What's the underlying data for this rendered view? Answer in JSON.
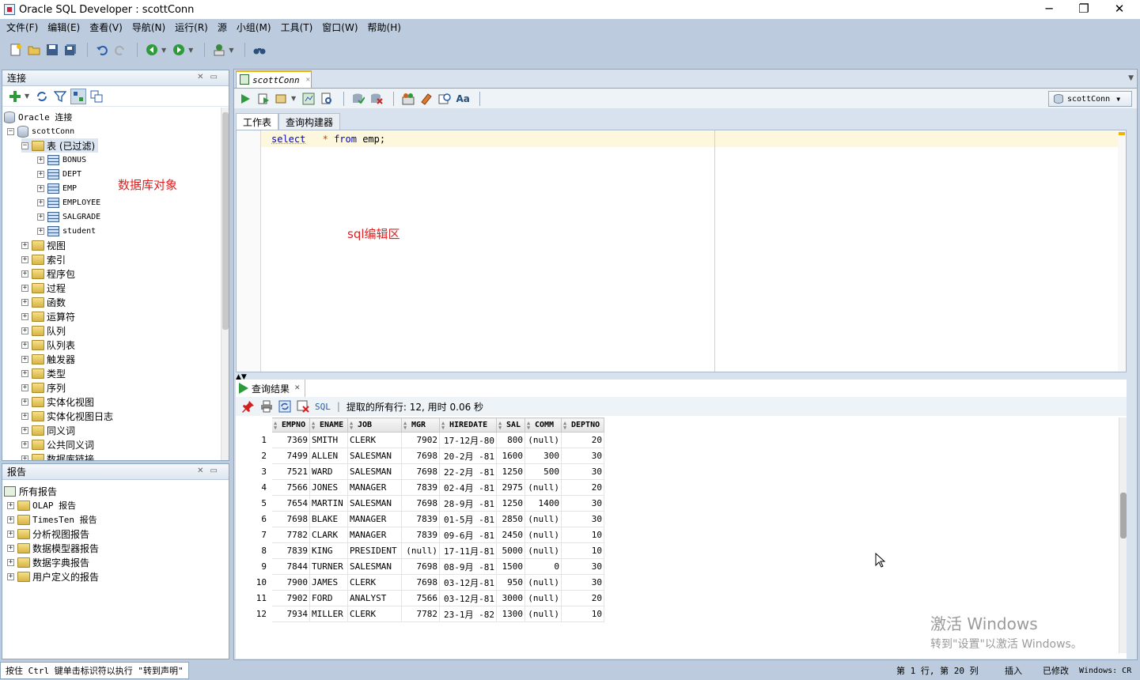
{
  "window": {
    "title": "Oracle SQL Developer : scottConn",
    "min": "─",
    "max": "❐",
    "close": "✕"
  },
  "menu": [
    "文件(F)",
    "编辑(E)",
    "查看(V)",
    "导航(N)",
    "运行(R)",
    "源",
    "小组(M)",
    "工具(T)",
    "窗口(W)",
    "帮助(H)"
  ],
  "connections_panel": {
    "title": "连接",
    "root": "Oracle 连接",
    "connection": "scottConn",
    "tables_node": "表 (已过滤)",
    "tables": [
      "BONUS",
      "DEPT",
      "EMP",
      "EMPLOYEE",
      "SALGRADE",
      "student"
    ],
    "annotation": "数据库对象",
    "nodes": [
      "视图",
      "索引",
      "程序包",
      "过程",
      "函数",
      "运算符",
      "队列",
      "队列表",
      "触发器",
      "类型",
      "序列",
      "实体化视图",
      "实体化视图日志",
      "同义词",
      "公共同义词",
      "数据库链接"
    ]
  },
  "reports_panel": {
    "title": "报告",
    "root": "所有报告",
    "items": [
      "OLAP 报告",
      "TimesTen 报告",
      "分析视图报告",
      "数据模型器报告",
      "数据字典报告",
      "用户定义的报告"
    ]
  },
  "editor": {
    "tab": "scottConn",
    "connection_selector": "scottConn",
    "subtabs": [
      "工作表",
      "查询构建器"
    ],
    "sql": {
      "kw1": "select",
      "star": "*",
      "kw2": "from",
      "rest": "emp;"
    },
    "annotation": "sql编辑区"
  },
  "results": {
    "tab": "查询结果",
    "sql_link": "SQL",
    "status": "提取的所有行: 12, 用时 0.06 秒",
    "columns": [
      "EMPNO",
      "ENAME",
      "JOB",
      "MGR",
      "HIREDATE",
      "SAL",
      "COMM",
      "DEPTNO"
    ],
    "rows": [
      [
        "1",
        "7369",
        "SMITH",
        "CLERK",
        "7902",
        "17-12月-80",
        "800",
        "(null)",
        "20"
      ],
      [
        "2",
        "7499",
        "ALLEN",
        "SALESMAN",
        "7698",
        "20-2月 -81",
        "1600",
        "300",
        "30"
      ],
      [
        "3",
        "7521",
        "WARD",
        "SALESMAN",
        "7698",
        "22-2月 -81",
        "1250",
        "500",
        "30"
      ],
      [
        "4",
        "7566",
        "JONES",
        "MANAGER",
        "7839",
        "02-4月 -81",
        "2975",
        "(null)",
        "20"
      ],
      [
        "5",
        "7654",
        "MARTIN",
        "SALESMAN",
        "7698",
        "28-9月 -81",
        "1250",
        "1400",
        "30"
      ],
      [
        "6",
        "7698",
        "BLAKE",
        "MANAGER",
        "7839",
        "01-5月 -81",
        "2850",
        "(null)",
        "30"
      ],
      [
        "7",
        "7782",
        "CLARK",
        "MANAGER",
        "7839",
        "09-6月 -81",
        "2450",
        "(null)",
        "10"
      ],
      [
        "8",
        "7839",
        "KING",
        "PRESIDENT",
        "(null)",
        "17-11月-81",
        "5000",
        "(null)",
        "10"
      ],
      [
        "9",
        "7844",
        "TURNER",
        "SALESMAN",
        "7698",
        "08-9月 -81",
        "1500",
        "0",
        "30"
      ],
      [
        "10",
        "7900",
        "JAMES",
        "CLERK",
        "7698",
        "03-12月-81",
        "950",
        "(null)",
        "30"
      ],
      [
        "11",
        "7902",
        "FORD",
        "ANALYST",
        "7566",
        "03-12月-81",
        "3000",
        "(null)",
        "20"
      ],
      [
        "12",
        "7934",
        "MILLER",
        "CLERK",
        "7782",
        "23-1月 -82",
        "1300",
        "(null)",
        "10"
      ]
    ]
  },
  "watermark": {
    "line1": "激活 Windows",
    "line2": "转到\"设置\"以激活 Windows。"
  },
  "statusbar": {
    "hint": "按住 Ctrl 键单击标识符以执行 \"转到声明\"",
    "position": "第 1 行, 第 20 列",
    "mode": "插入",
    "modified": "已修改",
    "eol": "Windows: CR"
  },
  "colors": {
    "accent": "#f0b400",
    "keyword": "#0000c8",
    "annotation": "#e02020",
    "chrome": "#bcccde"
  }
}
